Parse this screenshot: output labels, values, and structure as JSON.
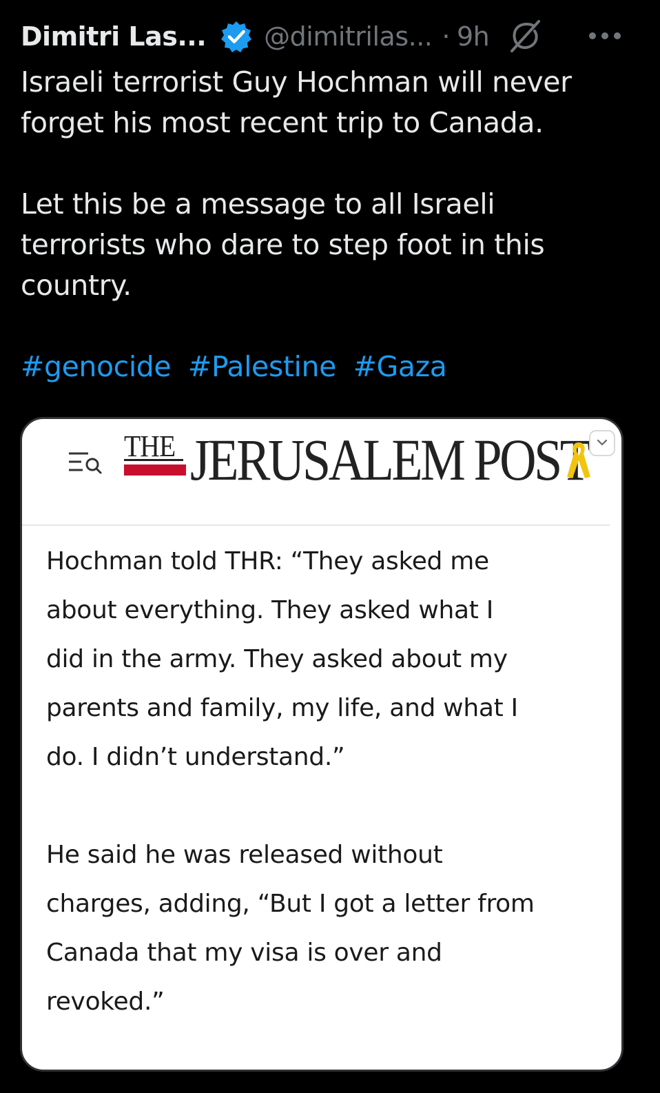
{
  "tweet": {
    "author": {
      "display_name": "Dimitri Las...",
      "handle": "@dimitrilas...",
      "verified": true
    },
    "separator": "·",
    "timestamp": "9h",
    "icons": {
      "verified": "verified-badge-icon",
      "grok": "grok-icon",
      "more": "more-options-icon"
    },
    "body_lines": [
      "Israeli terrorist Guy Hochman will never",
      "forget his most recent trip to Canada.",
      "",
      "Let this be a message to all Israeli",
      "terrorists who dare to step foot in this",
      "country.",
      ""
    ],
    "hashtags": [
      "#genocide",
      "#Palestine",
      "#Gaza"
    ],
    "colors": {
      "background": "#000000",
      "text": "#e7e9ea",
      "muted": "#71767b",
      "link": "#1d9bf0",
      "verified": "#1d9bf0"
    }
  },
  "media": {
    "publication": {
      "logo_prefix": "THE",
      "logo_name": "JERUSALEM POST",
      "logo_accent": "#c8102e",
      "ribbon_color": "#f2c40f",
      "icons": {
        "menu": "menu-search-icon",
        "ribbon": "yellow-ribbon-icon",
        "dropdown": "chevron-down-icon"
      }
    },
    "article_lines": [
      "Hochman told THR: “They asked me",
      "about everything. They asked what I",
      "did in the army. They asked about my",
      "parents and family, my life, and what I",
      "do. I didn’t understand.”",
      "",
      "He said he was released without",
      "charges, adding, “But I got a letter from",
      "Canada that my visa is over and",
      "revoked.”"
    ]
  }
}
